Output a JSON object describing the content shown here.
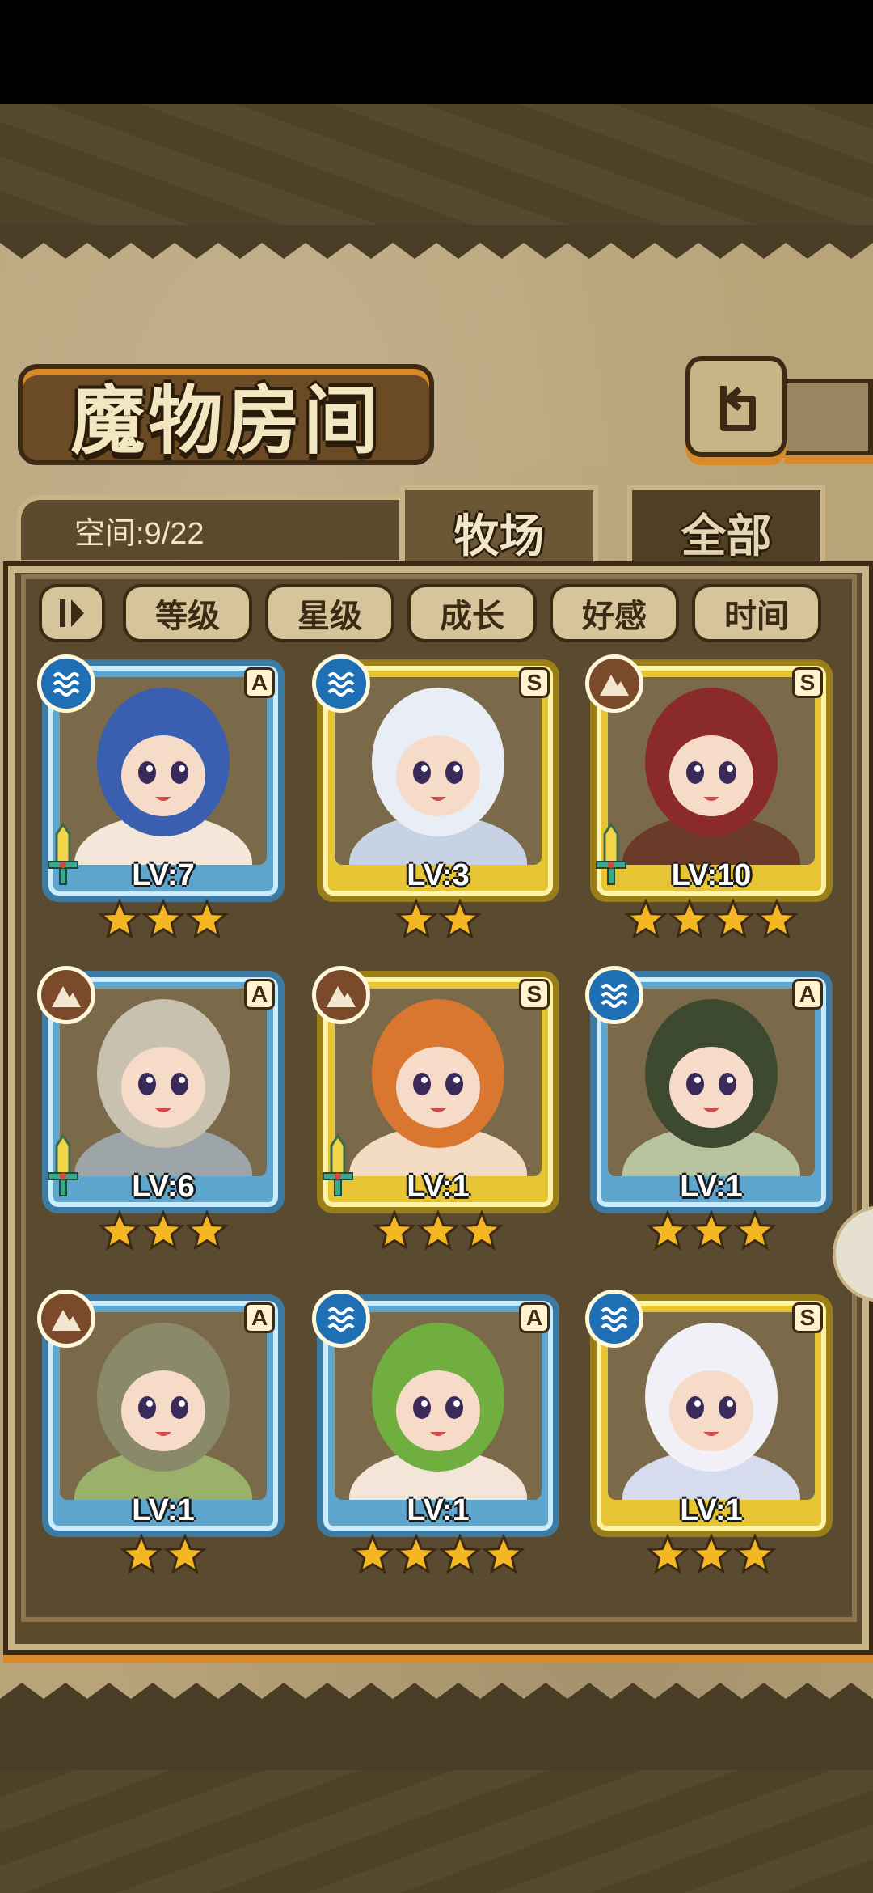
{
  "title": "魔物房间",
  "space": {
    "label": "空间:9/22"
  },
  "tabs": [
    {
      "label": "牧场",
      "active": true
    },
    {
      "label": "全部",
      "active": false
    }
  ],
  "filters": [
    "等级",
    "星级",
    "成长",
    "好感",
    "时间"
  ],
  "icons": {
    "back": "back-arrow-icon",
    "filter": "filter-toggle-icon",
    "water": "water-element-icon",
    "earth": "earth-element-icon",
    "sword": "sword-icon",
    "star": "star-icon"
  },
  "colors": {
    "rarityA": "#5fa6cf",
    "rarityS": "#e7c532",
    "star": "#f5b624",
    "panel": "#5a4a2f",
    "board": "#b9a47a"
  },
  "monsters": [
    {
      "rank": "A",
      "element": "water",
      "level": "LV:7",
      "stars": 3,
      "sword": true
    },
    {
      "rank": "S",
      "element": "water",
      "level": "LV:3",
      "stars": 2,
      "sword": false
    },
    {
      "rank": "S",
      "element": "earth",
      "level": "LV:10",
      "stars": 4,
      "sword": true
    },
    {
      "rank": "A",
      "element": "earth",
      "level": "LV:6",
      "stars": 3,
      "sword": true
    },
    {
      "rank": "S",
      "element": "earth",
      "level": "LV:1",
      "stars": 3,
      "sword": true
    },
    {
      "rank": "A",
      "element": "water",
      "level": "LV:1",
      "stars": 3,
      "sword": false
    },
    {
      "rank": "A",
      "element": "earth",
      "level": "LV:1",
      "stars": 2,
      "sword": false
    },
    {
      "rank": "A",
      "element": "water",
      "level": "LV:1",
      "stars": 4,
      "sword": false
    },
    {
      "rank": "S",
      "element": "water",
      "level": "LV:1",
      "stars": 3,
      "sword": false
    }
  ]
}
